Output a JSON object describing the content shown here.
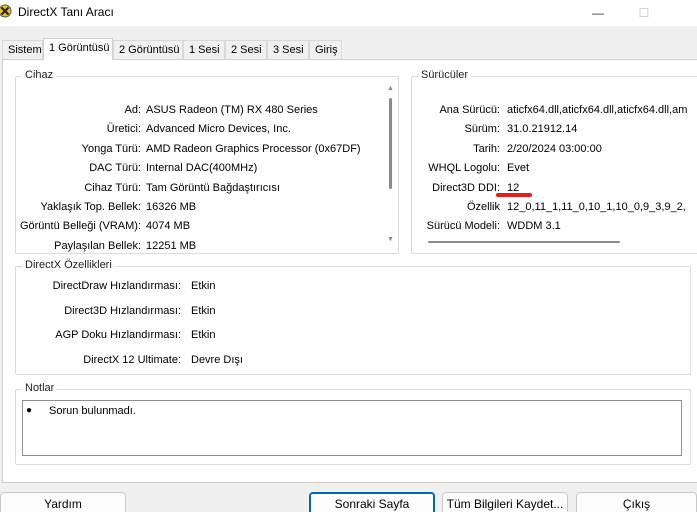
{
  "window": {
    "title": "DirectX Tanı Aracı",
    "minimize_icon": "minimize-icon",
    "maximize_icon": "maximize-icon"
  },
  "tabs": [
    {
      "label": "Sistem"
    },
    {
      "label": "1 Görüntüsü"
    },
    {
      "label": "2 Görüntüsü"
    },
    {
      "label": "1 Sesi"
    },
    {
      "label": "2 Sesi"
    },
    {
      "label": "3 Sesi"
    },
    {
      "label": "Giriş"
    }
  ],
  "device": {
    "title": "Cihaz",
    "rows": [
      {
        "label": "Ad:",
        "value": "ASUS Radeon (TM) RX 480 Series"
      },
      {
        "label": "Üretici:",
        "value": "Advanced Micro Devices, Inc."
      },
      {
        "label": "Yonga Türü:",
        "value": "AMD Radeon Graphics Processor (0x67DF)"
      },
      {
        "label": "DAC Türü:",
        "value": "Internal DAC(400MHz)"
      },
      {
        "label": "Cihaz Türü:",
        "value": "Tam Görüntü Bağdaştırıcısı"
      },
      {
        "label": "Yaklaşık Top. Bellek:",
        "value": "16326 MB"
      },
      {
        "label": "Görüntü Belleği (VRAM):",
        "value": "4074 MB"
      },
      {
        "label": "Paylaşılan Bellek:",
        "value": "12251 MB"
      }
    ]
  },
  "drivers": {
    "title": "Sürücüler",
    "rows": [
      {
        "label": "Ana Sürücü:",
        "value": "aticfx64.dll,aticfx64.dll,aticfx64.dll,am"
      },
      {
        "label": "Sürüm:",
        "value": "31.0.21912.14"
      },
      {
        "label": "Tarih:",
        "value": "2/20/2024 03:00:00"
      },
      {
        "label": "WHQL Logolu:",
        "value": "Evet"
      },
      {
        "label": "Direct3D DDI:",
        "value": "12"
      },
      {
        "label": "Özellik",
        "value": "12_0,11_1,11_0,10_1,10_0,9_3,9_2,"
      },
      {
        "label": "Sürücü Modeli:",
        "value": "WDDM 3.1"
      }
    ]
  },
  "features": {
    "title": "DirectX Özellikleri",
    "rows": [
      {
        "label": "DirectDraw Hızlandırması:",
        "value": "Etkin"
      },
      {
        "label": "Direct3D Hızlandırması:",
        "value": "Etkin"
      },
      {
        "label": "AGP Doku Hızlandırması:",
        "value": "Etkin"
      },
      {
        "label": "DirectX 12 Ultimate:",
        "value": "Devre Dışı"
      }
    ]
  },
  "notes": {
    "title": "Notlar",
    "items": [
      "Sorun bulunmadı."
    ]
  },
  "buttons": {
    "help": "Yardım",
    "next": "Sonraki Sayfa",
    "save": "Tüm Bilgileri Kaydet...",
    "exit": "Çıkış"
  },
  "colors": {
    "accent": "#0067c0",
    "highlight_mark": "#e02020"
  }
}
